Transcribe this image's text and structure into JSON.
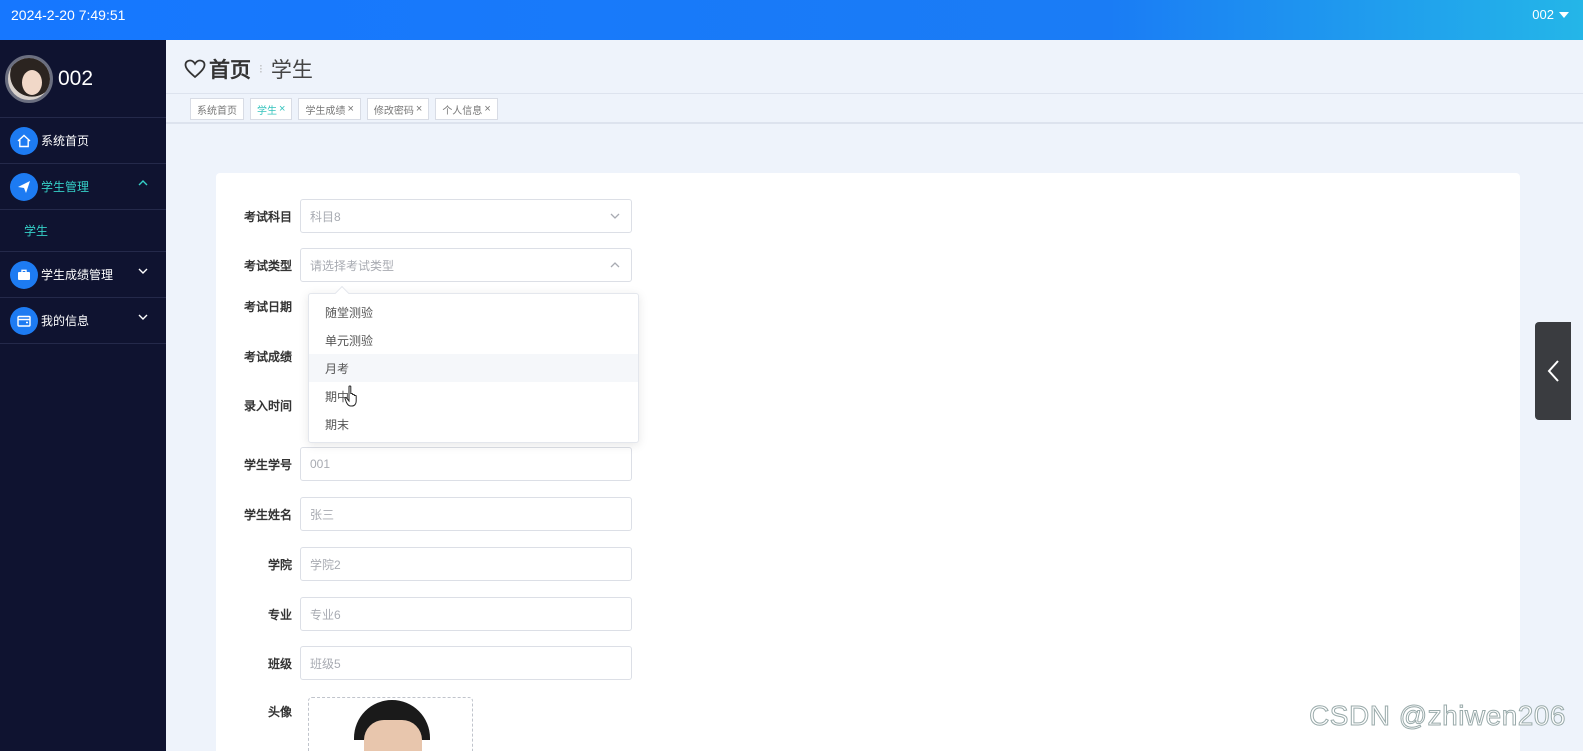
{
  "topbar": {
    "datetime": "2024-2-20 7:49:51",
    "user": "002"
  },
  "sidebar": {
    "username": "002",
    "items": [
      {
        "label": "系统首页",
        "icon": "home-icon"
      },
      {
        "label": "学生管理",
        "icon": "send-icon",
        "expanded": true,
        "children": [
          {
            "label": "学生"
          }
        ]
      },
      {
        "label": "学生成绩管理",
        "icon": "briefcase-icon"
      },
      {
        "label": "我的信息",
        "icon": "wallet-icon"
      }
    ]
  },
  "breadcrumb": {
    "home": "首页",
    "current": "学生"
  },
  "tabs": [
    {
      "label": "系统首页",
      "closable": false,
      "active": false
    },
    {
      "label": "学生",
      "closable": true,
      "active": true
    },
    {
      "label": "学生成绩",
      "closable": true,
      "active": false
    },
    {
      "label": "修改密码",
      "closable": true,
      "active": false
    },
    {
      "label": "个人信息",
      "closable": true,
      "active": false
    }
  ],
  "form": {
    "subject": {
      "label": "考试科目",
      "value": "科目8"
    },
    "exam_type": {
      "label": "考试类型",
      "placeholder": "请选择考试类型"
    },
    "exam_date": {
      "label": "考试日期"
    },
    "exam_score": {
      "label": "考试成绩"
    },
    "entry_time": {
      "label": "录入时间"
    },
    "student_no": {
      "label": "学生学号",
      "value": "001"
    },
    "student_name": {
      "label": "学生姓名",
      "value": "张三"
    },
    "college": {
      "label": "学院",
      "value": "学院2"
    },
    "major": {
      "label": "专业",
      "value": "专业6"
    },
    "class": {
      "label": "班级",
      "value": "班级5"
    },
    "avatar": {
      "label": "头像"
    }
  },
  "dropdown": {
    "options": [
      "随堂测验",
      "单元测验",
      "月考",
      "期中",
      "期末"
    ],
    "hovered": 2
  },
  "watermark": "CSDN @zhiwen206",
  "colors": {
    "primary": "#1677ff",
    "sidebar": "#0f1330",
    "accent": "#35d0c8"
  }
}
